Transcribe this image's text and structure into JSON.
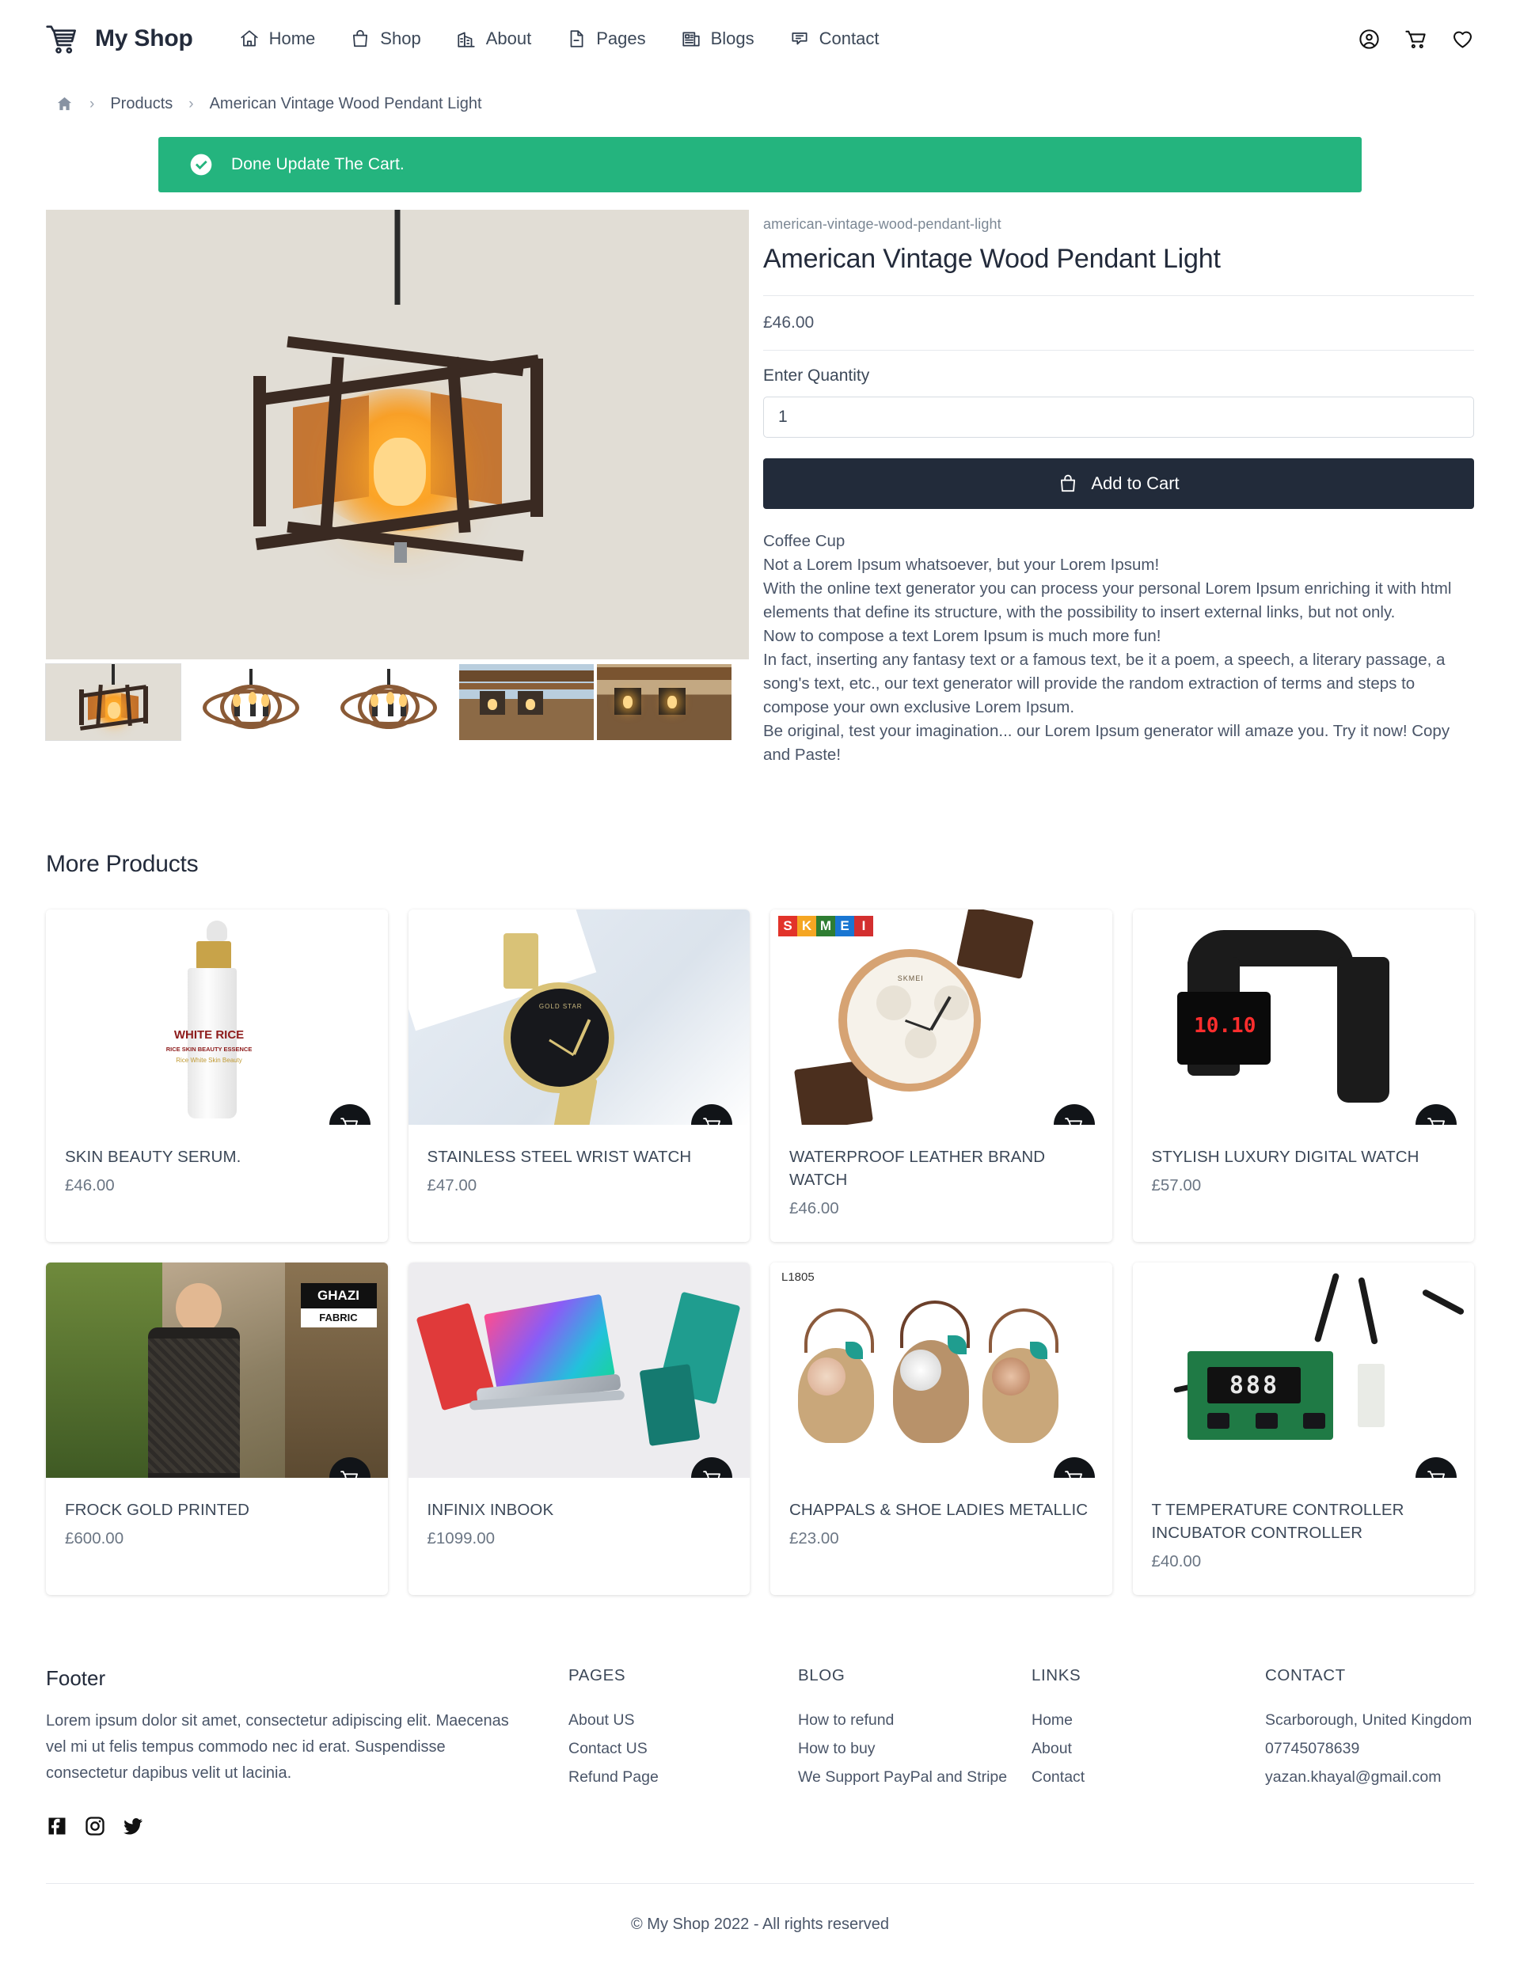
{
  "header": {
    "brand": "My Shop",
    "brand_icon": "shopping-cart-icon",
    "nav": [
      {
        "label": "Home",
        "icon": "home-icon"
      },
      {
        "label": "Shop",
        "icon": "shopping-bag-icon"
      },
      {
        "label": "About",
        "icon": "buildings-icon"
      },
      {
        "label": "Pages",
        "icon": "file-icon"
      },
      {
        "label": "Blogs",
        "icon": "newspaper-icon"
      },
      {
        "label": "Contact",
        "icon": "chat-bubble-icon"
      }
    ],
    "actions": [
      {
        "name": "account-icon"
      },
      {
        "name": "cart-icon"
      },
      {
        "name": "wishlist-heart-icon"
      }
    ]
  },
  "breadcrumb": {
    "home_icon": "home-icon",
    "separator": "›",
    "items": [
      {
        "label": "Products"
      },
      {
        "label": "American Vintage Wood Pendant Light"
      }
    ]
  },
  "alert": {
    "message": "Done Update The Cart.",
    "icon": "check-circle-icon",
    "color": "#24b47e"
  },
  "product": {
    "slug": "american-vintage-wood-pendant-light",
    "title": "American Vintage Wood Pendant Light",
    "price": "£46.00",
    "quantity_label": "Enter Quantity",
    "quantity_value": "1",
    "quantity_placeholder": "1",
    "add_to_cart_label": "Add to Cart",
    "add_to_cart_icon": "shopping-bag-icon",
    "add_to_cart_color": "#222b3a",
    "description_heading": "Coffee Cup",
    "description_lines": [
      "Not a Lorem Ipsum whatsoever, but your Lorem Ipsum!",
      "With the online text generator you can process your personal Lorem Ipsum enriching it with html elements that define its structure, with the possibility to insert external links, but not only.",
      "Now to compose a text Lorem Ipsum is much more fun!",
      "In fact, inserting any fantasy text or a famous text, be it a poem, a speech, a literary passage, a song's text, etc., our text generator will provide the random extraction of terms and steps to compose your own exclusive Lorem Ipsum.",
      "Be original, test your imagination... our Lorem Ipsum generator will amaze you. Try it now! Copy and Paste!"
    ],
    "thumbnails": [
      {
        "alt": "pendant light front view",
        "selected": true
      },
      {
        "alt": "round wood chandelier",
        "selected": false
      },
      {
        "alt": "round wood chandelier alt",
        "selected": false
      },
      {
        "alt": "pendant lights outdoor",
        "selected": false
      },
      {
        "alt": "pendant lights ceiling",
        "selected": false
      }
    ]
  },
  "more_products": {
    "title": "More Products",
    "cart_icon": "shopping-cart-icon",
    "items": [
      {
        "name": "SKIN BEAUTY SERUM.",
        "price": "£46.00",
        "art": "serum"
      },
      {
        "name": "STAINLESS STEEL WRIST WATCH",
        "price": "£47.00",
        "art": "watch-black"
      },
      {
        "name": "WATERPROOF LEATHER BRAND WATCH",
        "price": "£46.00",
        "art": "watch-skmei"
      },
      {
        "name": "STYLISH LUXURY DIGITAL WATCH",
        "price": "£57.00",
        "art": "watch-digital"
      },
      {
        "name": "FROCK GOLD PRINTED",
        "price": "£600.00",
        "art": "frock"
      },
      {
        "name": "INFINIX INBOOK",
        "price": "£1099.00",
        "art": "laptop"
      },
      {
        "name": "CHAPPALS & SHOE LADIES METALLIC",
        "price": "£23.00",
        "art": "chappals"
      },
      {
        "name": "T TEMPERATURE CONTROLLER INCUBATOR CONTROLLER",
        "price": "£40.00",
        "art": "pcb"
      }
    ]
  },
  "card_art_text": {
    "serum_title": "WHITE RICE",
    "serum_sub": "RICE SKIN BEAUTY ESSENCE",
    "serum_sub2": "Rice White Skin Beauty",
    "skmei_brand": "SKMEI",
    "digital_time": "10.10",
    "frock_tag": "GHAZI",
    "frock_tag2": "FABRIC",
    "chappals_code": "L1805",
    "pcb_digits": "888"
  },
  "footer": {
    "title": "Footer",
    "about": "Lorem ipsum dolor sit amet, consectetur adipiscing elit. Maecenas vel mi ut felis tempus commodo nec id erat. Suspendisse consectetur dapibus velit ut lacinia.",
    "socials": [
      {
        "name": "facebook-icon"
      },
      {
        "name": "instagram-icon"
      },
      {
        "name": "twitter-icon"
      }
    ],
    "columns": [
      {
        "heading": "PAGES",
        "links": [
          "About US",
          "Contact US",
          "Refund Page"
        ]
      },
      {
        "heading": "BLOG",
        "links": [
          "How to refund",
          "How to buy",
          "We Support PayPal and Stripe"
        ]
      },
      {
        "heading": "LINKS",
        "links": [
          "Home",
          "About",
          "Contact"
        ]
      },
      {
        "heading": "CONTACT",
        "links": [
          "Scarborough, United Kingdom",
          "07745078639",
          "yazan.khayal@gmail.com"
        ]
      }
    ],
    "copyright": "© My Shop 2022 - All rights reserved"
  }
}
